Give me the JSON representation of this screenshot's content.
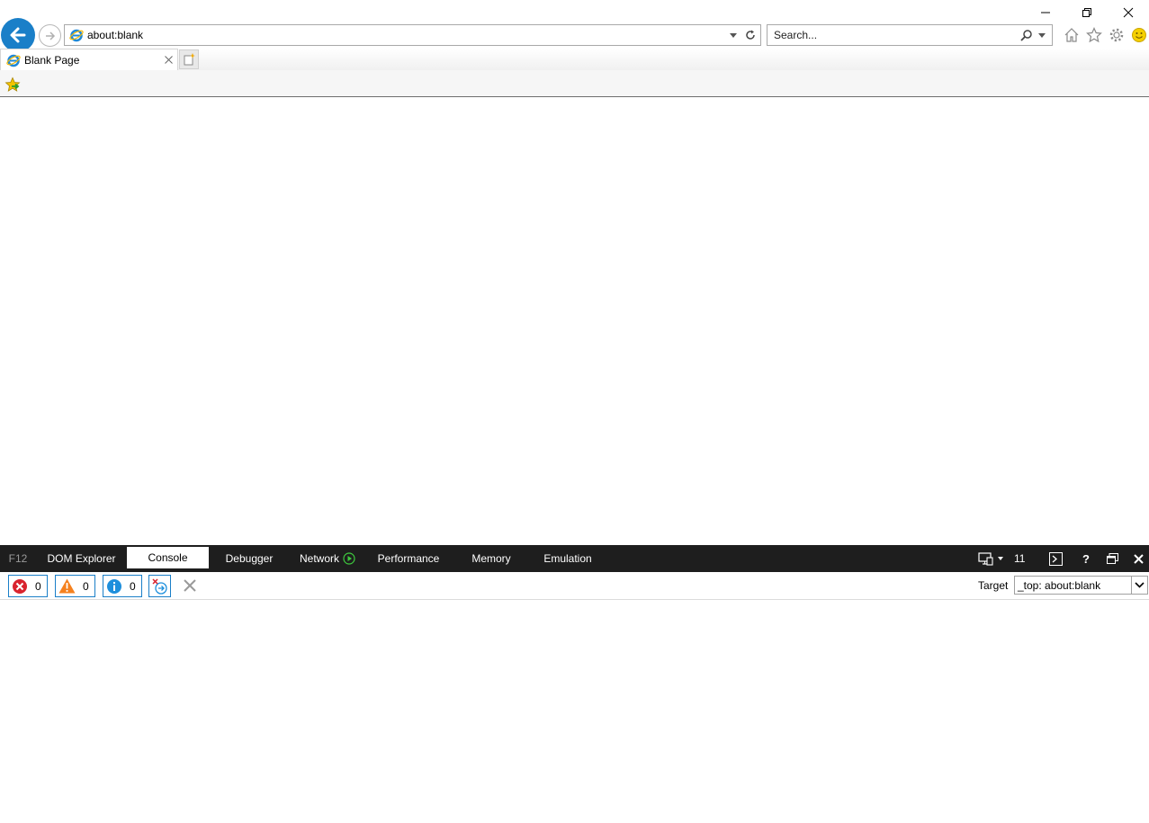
{
  "browser": {
    "address_url": "about:blank",
    "search_placeholder": "Search...",
    "tab_title": "Blank Page",
    "icons": [
      "back-arrow-icon",
      "forward-arrow-icon",
      "ie-logo-icon",
      "dropdown-icon",
      "refresh-icon",
      "search-icon",
      "home-icon",
      "favorites-star-icon",
      "gear-icon",
      "smiley-feedback-icon",
      "add-favorite-icon",
      "new-tab-icon",
      "close-icon"
    ],
    "accent_color": "#1a7fc8"
  },
  "devtools": {
    "f12_label": "F12",
    "tabs": [
      {
        "label": "DOM Explorer"
      },
      {
        "label": "Console"
      },
      {
        "label": "Debugger"
      },
      {
        "label": "Network"
      },
      {
        "label": "Performance"
      },
      {
        "label": "Memory"
      },
      {
        "label": "Emulation"
      }
    ],
    "active_tab": "Console",
    "document_mode": "11",
    "counts": {
      "errors": "0",
      "warnings": "0",
      "messages": "0"
    },
    "target_label": "Target",
    "target_value": "_top: about:blank"
  }
}
